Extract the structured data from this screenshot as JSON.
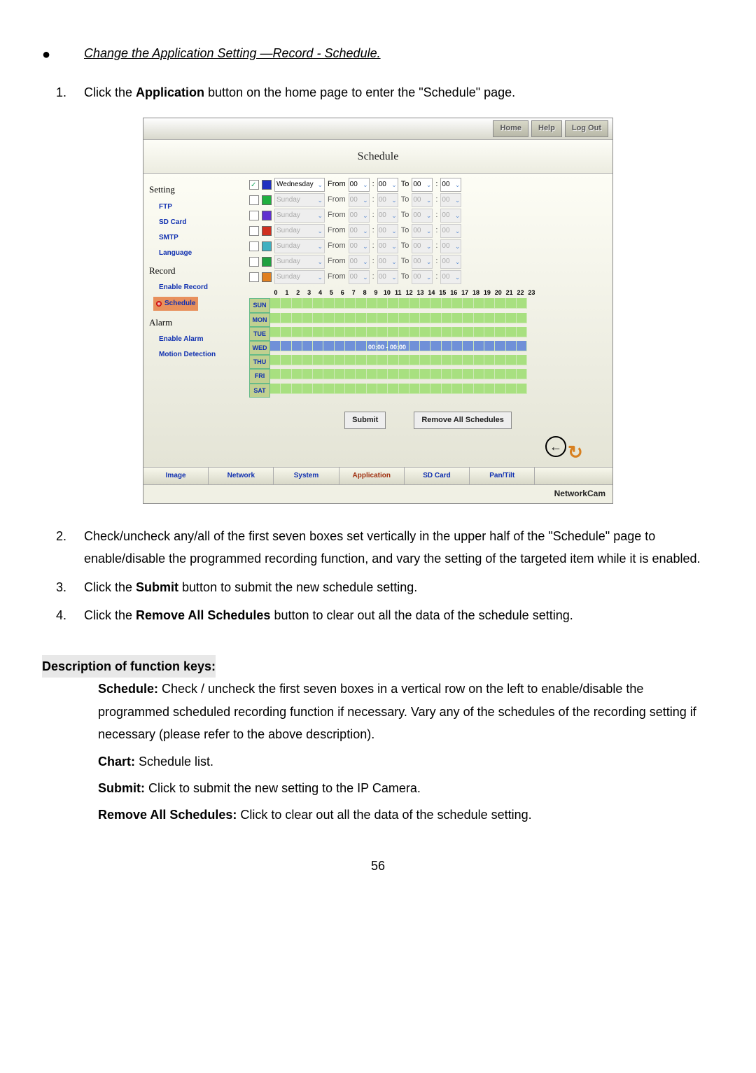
{
  "heading": "Change the Application Setting —Record - Schedule.",
  "step1_pre": "Click the ",
  "step1_bold": "Application",
  "step1_post": " button on the home page to enter the \"Schedule\" page.",
  "step2": "Check/uncheck any/all of the first seven boxes set vertically in the upper half of the \"Schedule\" page to enable/disable the programmed recording function, and vary the setting of the targeted item while it is enabled.",
  "step3_pre": "Click the ",
  "step3_bold": "Submit",
  "step3_post": " button to submit the new schedule setting.",
  "step4_pre": "Click the ",
  "step4_bold": "Remove All Schedules",
  "step4_post": " button to clear out all the data of the schedule setting.",
  "desc_heading": "Description of function keys:",
  "desc_schedule_k": "Schedule:",
  "desc_schedule_v": " Check / uncheck the first seven boxes in a vertical row on the left to enable/disable the programmed scheduled recording function if necessary. Vary any of the schedules of the recording setting if necessary (please refer to the above description).",
  "desc_chart_k": "Chart:",
  "desc_chart_v": " Schedule list.",
  "desc_submit_k": "Submit:",
  "desc_submit_v": " Click to submit the new setting to the IP Camera.",
  "desc_remove_k": "Remove All Schedules:",
  "desc_remove_v": " Click to clear out all the data of the schedule setting.",
  "page_number": "56",
  "ss": {
    "topbar": {
      "home": "Home",
      "help": "Help",
      "logout": "Log Out"
    },
    "title": "Schedule",
    "sidebar": {
      "setting": "Setting",
      "ftp": "FTP",
      "sdcard": "SD Card",
      "smtp": "SMTP",
      "language": "Language",
      "record": "Record",
      "enable_record": "Enable Record",
      "schedule": "Schedule",
      "alarm": "Alarm",
      "enable_alarm": "Enable Alarm",
      "motion": "Motion Detection"
    },
    "rows": [
      {
        "checked": true,
        "color": "#2030c0",
        "day": "Wednesday",
        "enabled": true
      },
      {
        "checked": false,
        "color": "#20b040",
        "day": "Sunday",
        "enabled": false
      },
      {
        "checked": false,
        "color": "#6030d0",
        "day": "Sunday",
        "enabled": false
      },
      {
        "checked": false,
        "color": "#d03020",
        "day": "Sunday",
        "enabled": false
      },
      {
        "checked": false,
        "color": "#40b0c0",
        "day": "Sunday",
        "enabled": false
      },
      {
        "checked": false,
        "color": "#20a040",
        "day": "Sunday",
        "enabled": false
      },
      {
        "checked": false,
        "color": "#e08020",
        "day": "Sunday",
        "enabled": false
      }
    ],
    "labels": {
      "from": "From",
      "to": "To",
      "val": "00",
      "colon": ":"
    },
    "grid": {
      "hours": [
        "0",
        "1",
        "2",
        "3",
        "4",
        "5",
        "6",
        "7",
        "8",
        "9",
        "10",
        "11",
        "12",
        "13",
        "14",
        "15",
        "16",
        "17",
        "18",
        "19",
        "20",
        "21",
        "22",
        "23"
      ],
      "days": [
        "SUN",
        "MON",
        "TUE",
        "WED",
        "THU",
        "FRI",
        "SAT"
      ],
      "overlay": "00:00 - 00:00"
    },
    "buttons": {
      "submit": "Submit",
      "remove": "Remove All Schedules"
    },
    "bottomTabs": [
      "Image",
      "Network",
      "System",
      "Application",
      "SD Card",
      "Pan/Tilt"
    ],
    "footer": "NetworkCam"
  }
}
